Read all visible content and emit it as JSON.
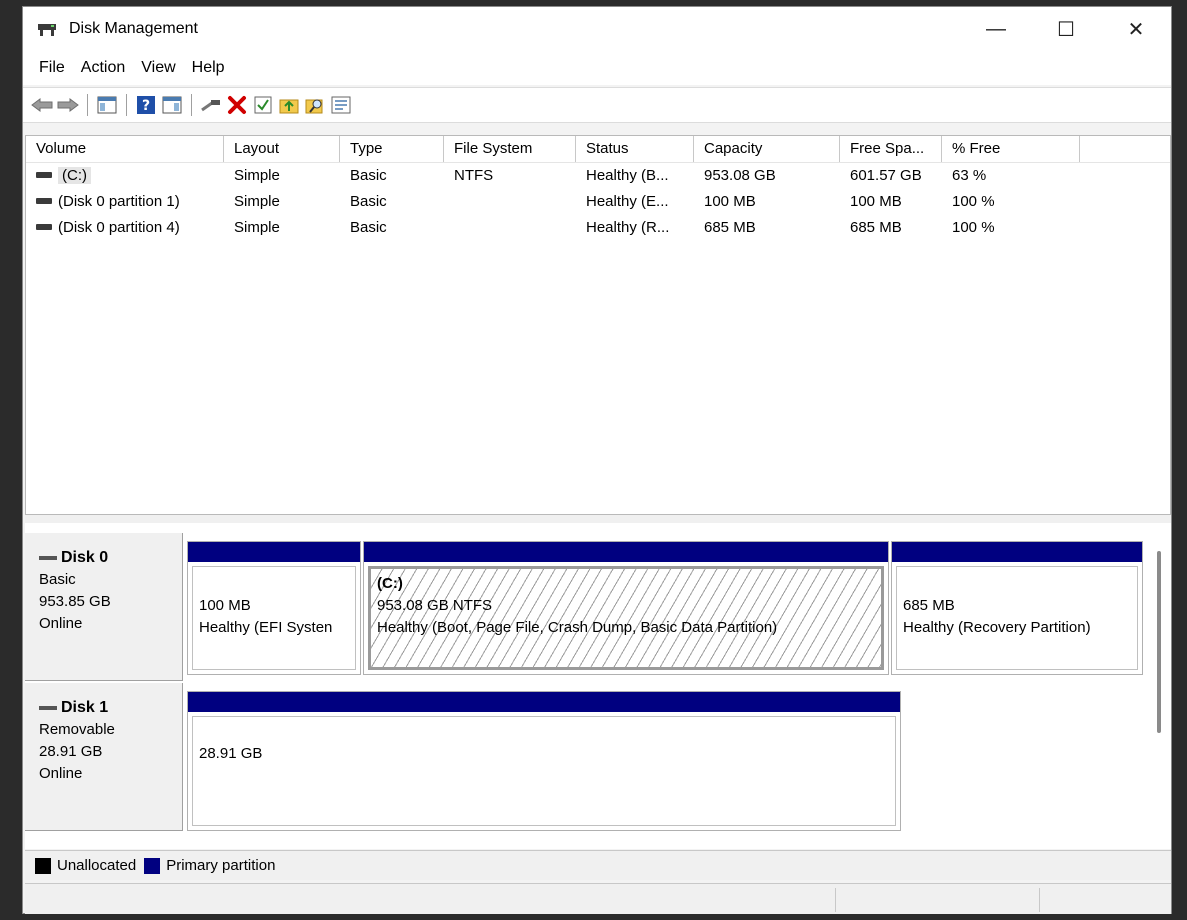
{
  "window": {
    "title": "Disk Management",
    "minimize_glyph": "—",
    "maximize_glyph": "☐",
    "close_glyph": "✕"
  },
  "menu": [
    "File",
    "Action",
    "View",
    "Help"
  ],
  "toolbar": {
    "icons": [
      "back-arrow-icon",
      "forward-arrow-icon",
      "console-tree-icon",
      "help-icon",
      "action-pane-icon",
      "connect-icon",
      "delete-icon",
      "check-icon",
      "up-folder-icon",
      "search-folder-icon",
      "properties-icon"
    ]
  },
  "list": {
    "columns": [
      "Volume",
      "Layout",
      "Type",
      "File System",
      "Status",
      "Capacity",
      "Free Spa...",
      "% Free",
      ""
    ],
    "rows": [
      [
        "(C:)",
        "Simple",
        "Basic",
        "NTFS",
        "Healthy (B...",
        "953.08 GB",
        "601.57 GB",
        "63 %"
      ],
      [
        "(Disk 0 partition 1)",
        "Simple",
        "Basic",
        "",
        "Healthy (E...",
        "100 MB",
        "100 MB",
        "100 %"
      ],
      [
        "(Disk 0 partition 4)",
        "Simple",
        "Basic",
        "",
        "Healthy (R...",
        "685 MB",
        "685 MB",
        "100 %"
      ]
    ]
  },
  "disks": [
    {
      "name": "Disk 0",
      "type": "Basic",
      "size": "953.85 GB",
      "state": "Online",
      "partitions": [
        {
          "name": "",
          "line1": "100 MB",
          "line2": "Healthy (EFI Systen"
        },
        {
          "name": "(C:)",
          "line1": "953.08 GB NTFS",
          "line2": "Healthy (Boot, Page File, Crash Dump, Basic Data Partition)"
        },
        {
          "name": "",
          "line1": "685 MB",
          "line2": "Healthy (Recovery Partition)"
        }
      ]
    },
    {
      "name": "Disk 1",
      "type": "Removable",
      "size": "28.91 GB",
      "state": "Online",
      "partitions": [
        {
          "name": "",
          "line1": "28.91 GB",
          "line2": ""
        }
      ]
    }
  ],
  "legend": [
    {
      "label": "Unallocated",
      "color": "#000000"
    },
    {
      "label": "Primary partition",
      "color": "#000080"
    }
  ],
  "colors": {
    "primary_partition": "#000080",
    "unallocated": "#000000",
    "close_icon_red": "#d00000"
  }
}
